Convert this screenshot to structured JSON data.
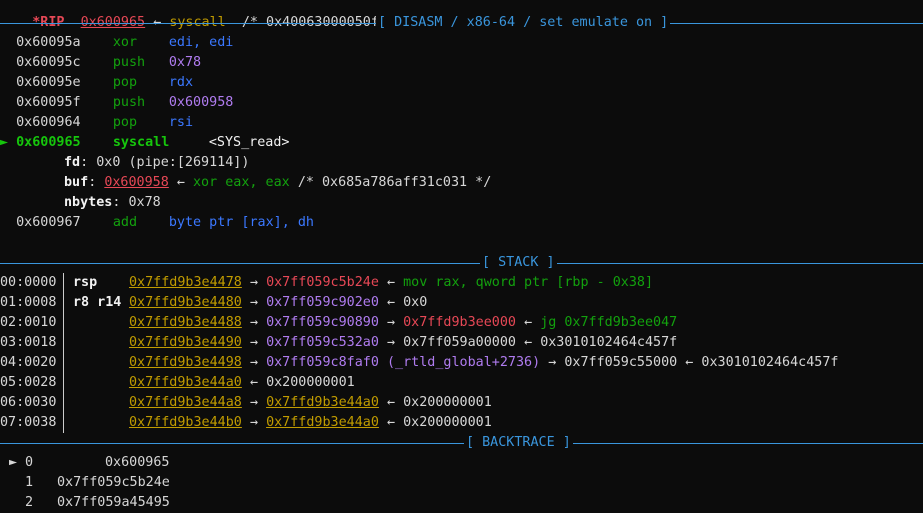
{
  "rip_line": {
    "label": "*RIP",
    "addr": "0x600965",
    "arrow": "←",
    "instr": "syscall",
    "comment": "/* 0x40063000050f */"
  },
  "disasm_header": "[ DISASM / x86-64 / set emulate on ]",
  "disasm": [
    {
      "addr": "0x60095a",
      "mnem": "xor",
      "ops": "edi, edi"
    },
    {
      "addr": "0x60095c",
      "mnem": "push",
      "ops": "0x78"
    },
    {
      "addr": "0x60095e",
      "mnem": "pop",
      "ops": "rdx"
    },
    {
      "addr": "0x60095f",
      "mnem": "push",
      "ops": "0x600958"
    },
    {
      "addr": "0x600964",
      "mnem": "pop",
      "ops": "rsi"
    },
    {
      "addr": "0x600965",
      "mnem": "syscall",
      "ops": "<SYS_read>",
      "current": true
    },
    {
      "addr": "0x600967",
      "mnem": "add",
      "ops": "byte ptr [rax], dh"
    }
  ],
  "current_marker": "►",
  "syscall_args": {
    "fd": {
      "name": "fd",
      "value": "0x0 (pipe:[269114])"
    },
    "buf": {
      "name": "buf",
      "addr": "0x600958",
      "arrow": "←",
      "instr": "xor eax, eax",
      "comment": "/* 0x685a786aff31c031 */"
    },
    "nbytes": {
      "name": "nbytes",
      "value": "0x78"
    }
  },
  "stack_header": "[ STACK ]",
  "stack": [
    {
      "idx": "00:0000",
      "reg": "rsp",
      "addr": "0x7ffd9b3e4478",
      "rest": [
        "→",
        "0x7ff059c5b24e",
        "←",
        "mov rax, qword ptr [rbp - 0x38]"
      ]
    },
    {
      "idx": "01:0008",
      "reg": "r8 r14",
      "addr": "0x7ffd9b3e4480",
      "rest": [
        "→",
        "0x7ff059c902e0",
        "←",
        "0x0"
      ]
    },
    {
      "idx": "02:0010",
      "reg": "",
      "addr": "0x7ffd9b3e4488",
      "rest": [
        "→",
        "0x7ff059c90890",
        "→",
        "0x7ffd9b3ee000",
        "←",
        "jg 0x7ffd9b3ee047"
      ]
    },
    {
      "idx": "03:0018",
      "reg": "",
      "addr": "0x7ffd9b3e4490",
      "rest": [
        "→",
        "0x7ff059c532a0",
        "→",
        "0x7ff059a00000",
        "←",
        "0x3010102464c457f"
      ]
    },
    {
      "idx": "04:0020",
      "reg": "",
      "addr": "0x7ffd9b3e4498",
      "rest": [
        "→",
        "0x7ff059c8faf0 (_rtld_global+2736)",
        "→",
        "0x7ff059c55000",
        "←",
        "0x3010102464c457f"
      ]
    },
    {
      "idx": "05:0028",
      "reg": "",
      "addr": "0x7ffd9b3e44a0",
      "rest": [
        "←",
        "0x200000001"
      ]
    },
    {
      "idx": "06:0030",
      "reg": "",
      "addr": "0x7ffd9b3e44a8",
      "rest": [
        "→",
        "0x7ffd9b3e44a0",
        "←",
        "0x200000001"
      ]
    },
    {
      "idx": "07:0038",
      "reg": "",
      "addr": "0x7ffd9b3e44b0",
      "rest": [
        "→",
        "0x7ffd9b3e44a0",
        "←",
        "0x200000001"
      ]
    }
  ],
  "backtrace_header": "[ BACKTRACE ]",
  "backtrace": [
    {
      "marker": "►",
      "num": "0",
      "addr": "0x600965"
    },
    {
      "marker": "",
      "num": "1",
      "addr": "0x7ff059c5b24e"
    },
    {
      "marker": "",
      "num": "2",
      "addr": "0x7ff059a45495"
    }
  ],
  "colors": {
    "background": "#0c0c0c",
    "separator": "#3a96dd",
    "stack_addr": "#c19c00",
    "code_addr": "#e74856",
    "mnemonic": "#13a10e",
    "immediate": "#b07cf0"
  }
}
